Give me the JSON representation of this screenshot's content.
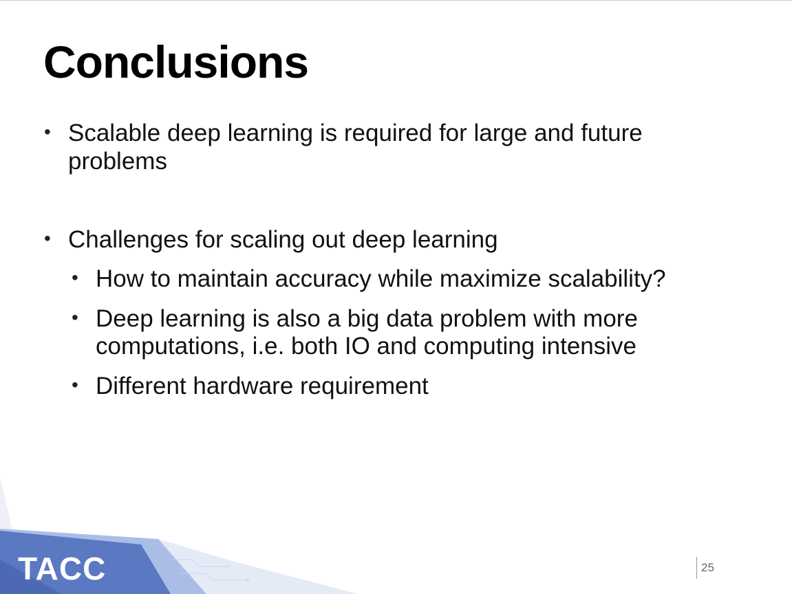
{
  "slide": {
    "title": "Conclusions",
    "page_number": "25",
    "logo_text": "TACC",
    "bullets": [
      {
        "text_line1": "Scalable deep learning is required for large and future",
        "text_line2": "problems"
      },
      {
        "text": "Challenges for scaling out deep learning",
        "sub_bullets": [
          {
            "text": "How to maintain accuracy while maximize scalability?"
          },
          {
            "text_line1": "Deep learning is also a big data problem with more",
            "text_line2": "computations, i.e. both IO and computing intensive"
          },
          {
            "text": "Different hardware requirement"
          }
        ]
      }
    ]
  },
  "colors": {
    "accent_blue": "#5b78c2",
    "light_blue": "#a9bde6",
    "text": "#111111"
  }
}
